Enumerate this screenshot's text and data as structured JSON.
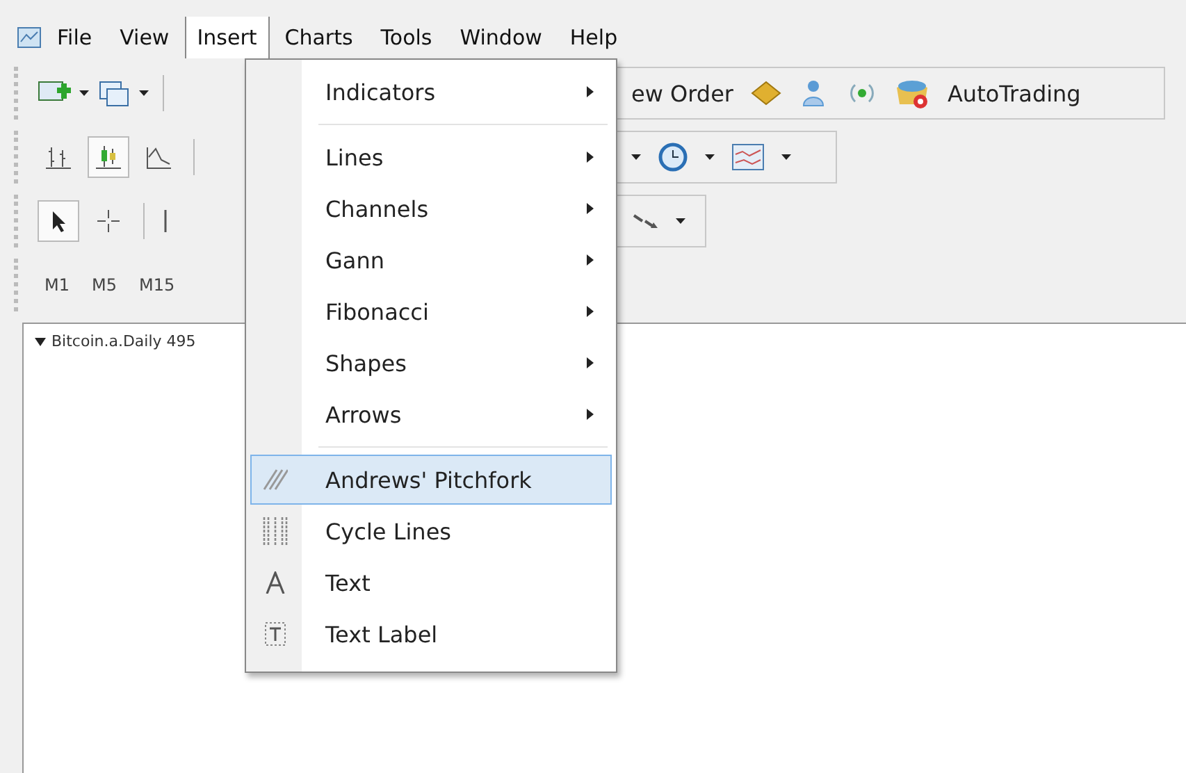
{
  "menu_bar": {
    "items": [
      {
        "label": "File",
        "selected": false
      },
      {
        "label": "View",
        "selected": false
      },
      {
        "label": "Insert",
        "selected": true
      },
      {
        "label": "Charts",
        "selected": false
      },
      {
        "label": "Tools",
        "selected": false
      },
      {
        "label": "Window",
        "selected": false
      },
      {
        "label": "Help",
        "selected": false
      }
    ]
  },
  "toolbar": {
    "order_label": "ew Order",
    "autotrading_label": "AutoTrading",
    "chart_types": [
      {
        "selected": false
      },
      {
        "selected": true
      },
      {
        "selected": false
      }
    ],
    "tools": [
      {
        "selected": true
      },
      {
        "selected": false
      }
    ],
    "timeframes": [
      "M1",
      "M5",
      "M15"
    ]
  },
  "chart": {
    "title": "Bitcoin.a.Daily 495"
  },
  "insert_menu": {
    "items": [
      {
        "kind": "submenu",
        "label": "Indicators",
        "selected": false
      },
      {
        "kind": "separator"
      },
      {
        "kind": "submenu",
        "label": "Lines",
        "selected": false
      },
      {
        "kind": "submenu",
        "label": "Channels",
        "selected": false
      },
      {
        "kind": "submenu",
        "label": "Gann",
        "selected": false
      },
      {
        "kind": "submenu",
        "label": "Fibonacci",
        "selected": false
      },
      {
        "kind": "submenu",
        "label": "Shapes",
        "selected": false
      },
      {
        "kind": "submenu",
        "label": "Arrows",
        "selected": false
      },
      {
        "kind": "separator"
      },
      {
        "kind": "pitchfork",
        "label": "Andrews' Pitchfork",
        "selected": true
      },
      {
        "kind": "cycle",
        "label": "Cycle Lines",
        "selected": false
      },
      {
        "kind": "text",
        "label": "Text",
        "selected": false
      },
      {
        "kind": "label",
        "label": "Text Label",
        "selected": false
      }
    ]
  }
}
